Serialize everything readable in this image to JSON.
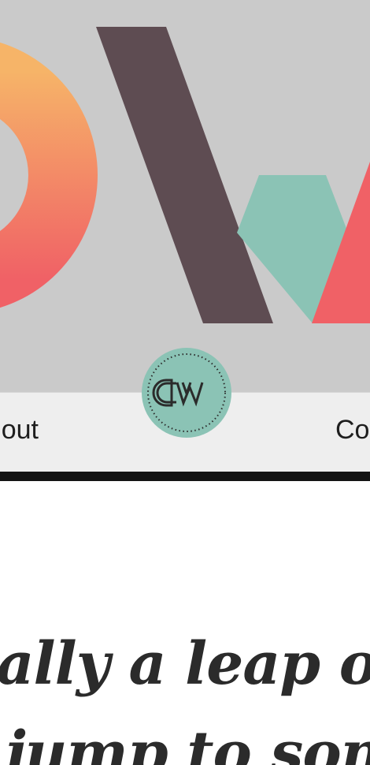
{
  "hero": {
    "artwork": "dw-letterforms-graphic",
    "colors": {
      "background": "#cacaca",
      "o_gradient_top": "#f6b468",
      "o_gradient_bottom": "#f06166",
      "w_stroke_dark": "#5e4c52",
      "w_stroke_teal": "#8bc3b5",
      "w_stroke_coral": "#f06166"
    }
  },
  "nav": {
    "left_label": "out",
    "right_label": "Co"
  },
  "logo": {
    "text": "DW",
    "badge_color": "#8bc3b5"
  },
  "quote": {
    "line1": "eally a leap of",
    "line2": "ou jump to som"
  }
}
